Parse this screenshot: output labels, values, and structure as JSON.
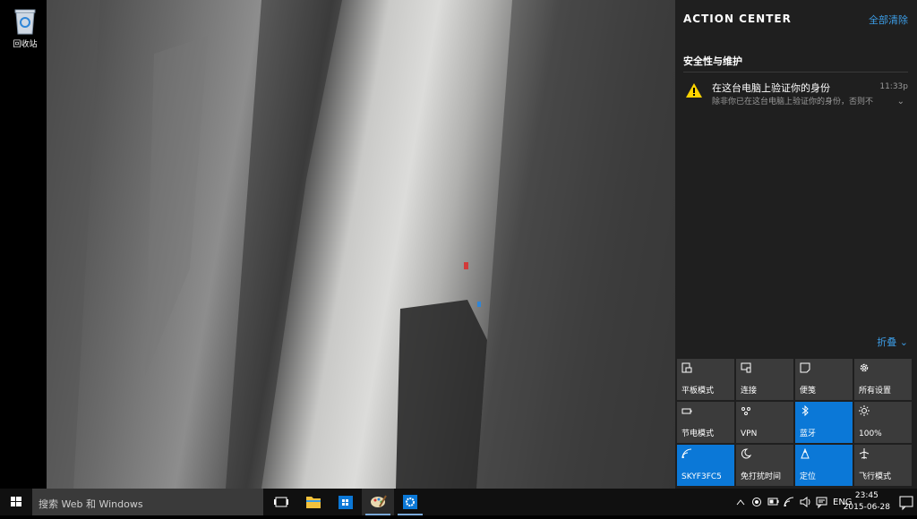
{
  "desktop": {
    "recycle_bin_label": "回收站"
  },
  "action_center": {
    "title": "ACTION CENTER",
    "clear_all": "全部清除",
    "group_title": "安全性与维护",
    "notification": {
      "title": "在这台电脑上验证你的身份",
      "body": "除非你已在这台电脑上验证你的身份，否则不",
      "time": "11:33p",
      "icon": "warning-icon"
    },
    "collapse_label": "折叠",
    "tiles": [
      {
        "label": "平板模式",
        "icon": "tablet-mode-icon",
        "active": false
      },
      {
        "label": "连接",
        "icon": "connect-icon",
        "active": false
      },
      {
        "label": "便笺",
        "icon": "note-icon",
        "active": false
      },
      {
        "label": "所有设置",
        "icon": "gear-icon",
        "active": false
      },
      {
        "label": "节电模式",
        "icon": "battery-saver-icon",
        "active": false
      },
      {
        "label": "VPN",
        "icon": "vpn-icon",
        "active": false
      },
      {
        "label": "蓝牙",
        "icon": "bluetooth-icon",
        "active": true
      },
      {
        "label": "100%",
        "icon": "brightness-icon",
        "active": false
      },
      {
        "label": "SKYF3FC5",
        "icon": "wifi-icon",
        "active": true
      },
      {
        "label": "免打扰时间",
        "icon": "moon-icon",
        "active": false
      },
      {
        "label": "定位",
        "icon": "location-icon",
        "active": true
      },
      {
        "label": "飞行模式",
        "icon": "airplane-icon",
        "active": false
      }
    ]
  },
  "taskbar": {
    "search_placeholder": "搜索 Web 和 Windows",
    "language": "ENG",
    "time": "23:45",
    "date": "2015-06-28"
  },
  "colors": {
    "accent": "#0b78d7",
    "link": "#3c9ce5",
    "panel": "#1f1f1f",
    "tile": "#3b3b3b",
    "warning": "#ffd400"
  }
}
